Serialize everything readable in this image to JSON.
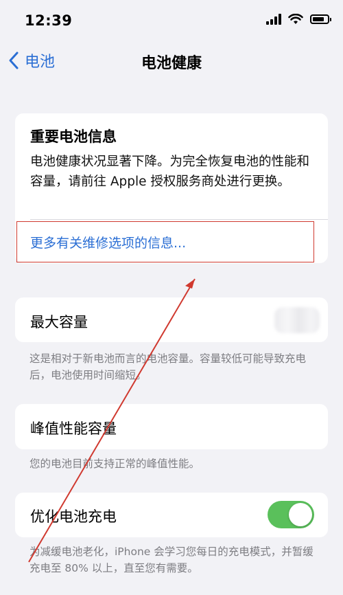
{
  "status_bar": {
    "time": "12:39"
  },
  "nav": {
    "back_label": "电池",
    "title": "电池健康"
  },
  "important_info": {
    "heading": "重要电池信息",
    "body": "电池健康状况显著下降。为完全恢复电池的性能和容量，请前往 Apple 授权服务商处进行更换。",
    "link": "更多有关维修选项的信息..."
  },
  "max_capacity": {
    "label": "最大容量",
    "note": "这是相对于新电池而言的电池容量。容量较低可能导致充电后，电池使用时间缩短。"
  },
  "peak_performance": {
    "label": "峰值性能容量",
    "note": "您的电池目前支持正常的峰值性能。"
  },
  "optimized_charging": {
    "label": "优化电池充电",
    "enabled": true,
    "note": "为减缓电池老化，iPhone 会学习您每日的充电模式，并暂缓充电至 80% 以上，直至您有需要。"
  },
  "colors": {
    "accent_blue": "#2a6ed4",
    "toggle_green": "#5ac05b",
    "annotation_red": "#d0392f",
    "background": "#f2f2f6"
  }
}
